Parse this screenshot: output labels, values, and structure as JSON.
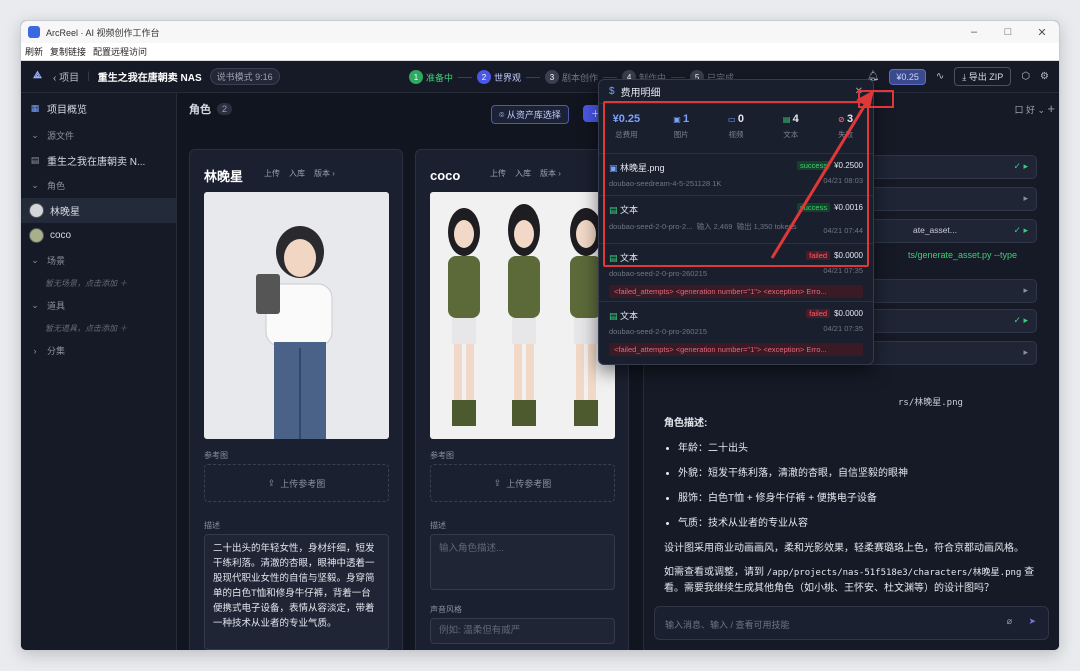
{
  "window": {
    "title": "ArcReel · AI 视频创作工作台",
    "controls": [
      "–",
      "□",
      "✕"
    ]
  },
  "menu": [
    "刷新",
    "复制链接",
    "配置远程访问"
  ],
  "topbar": {
    "back": "项目",
    "project_title": "重生之我在唐朝卖 NAS",
    "mode": "说书模式 9:16",
    "steps": [
      {
        "n": "1",
        "label": "准备中"
      },
      {
        "n": "2",
        "label": "世界观"
      },
      {
        "n": "3",
        "label": "剧本创作"
      },
      {
        "n": "4",
        "label": "制作中"
      },
      {
        "n": "5",
        "label": "已完成"
      }
    ],
    "cost": "¥0.25",
    "export": "导出 ZIP"
  },
  "sidebar": {
    "overview": "项目概览",
    "source": "源文件",
    "source_file": "重生之我在唐朝卖 N...",
    "characters": "角色",
    "char_items": [
      "林晚星",
      "coco"
    ],
    "scenes": "场景",
    "scenes_hint": "暂无场景，点击添加 ＋",
    "props": "道具",
    "props_hint": "暂无道具，点击添加 ＋",
    "episodes": "分集"
  },
  "main": {
    "title": "角色",
    "count": "2",
    "from_library": "从资产库选择",
    "add": "＋ 角色",
    "actions": [
      "上传",
      "入库",
      "版本 ›"
    ],
    "ref_label": "参考图",
    "upload_ref": "上传参考图",
    "desc_label": "描述",
    "voice_label": "声音风格",
    "cards": [
      {
        "name": "林晚星",
        "desc": "二十出头的年轻女性，身材纤细，短发干练利落。清澈的杏眼，眼神中透着一股现代职业女性的自信与坚毅。身穿简单的白色T恤和修身牛仔裤，背着一台便携式电子设备，表情从容淡定，带着一种技术从业者的专业气质。"
      },
      {
        "name": "coco",
        "desc_placeholder": "输入角色描述...",
        "voice_placeholder": "例如: 温柔但有威严"
      }
    ]
  },
  "chat": {
    "header": "口 好 ⌄",
    "tool_fragments": [
      "ate_asset...",
      "ts/generate_asset.py --type"
    ],
    "path_line": "rs/林晚星.png",
    "desc_heading": "角色描述:",
    "bullets": [
      "年龄：二十出头",
      "外貌：短发干练利落，清澈的杏眼，自信坚毅的眼神",
      "服饰：白色T恤 + 修身牛仔裤 + 便携电子设备",
      "气质：技术从业者的专业从容"
    ],
    "p1": "设计图采用商业动画画风，柔和光影效果，轻柔赛璐珞上色，符合京都动画风格。",
    "p2a": "如需查看或调整，请到 ",
    "p2path": "/app/projects/nas-51f518e3/characters/林晚星.png",
    "p2b": " 查看。需要我继续生成其他角色（如小桃、王怀安、杜文渊等）的设计图吗？",
    "input_placeholder": "输入消息、输入 / 查看可用技能"
  },
  "popup": {
    "title": "费用明细",
    "stats": [
      {
        "v": "¥0.25",
        "k": "总费用",
        "c": "#7aa2ff"
      },
      {
        "v": "1",
        "k": "图片",
        "c": "#7aa2ff"
      },
      {
        "v": "0",
        "k": "视频",
        "c": "#e4e7ee"
      },
      {
        "v": "4",
        "k": "文本",
        "c": "#3ccf77"
      },
      {
        "v": "3",
        "k": "失败",
        "c": "#ff5a6e"
      }
    ],
    "records": [
      {
        "title": "林晚星.png",
        "model": "doubao-seedream-4-5-251128  1K",
        "status": "success",
        "price": "¥0.2500",
        "time": "04/21 08:03"
      },
      {
        "title": "文本",
        "model": "doubao-seed-2-0-pro-2...",
        "in": "输入 2,469",
        "out": "输出 1,350 tokens",
        "status": "success",
        "price": "¥0.0016",
        "time": "04/21 07:44"
      },
      {
        "title": "文本",
        "model": "doubao-seed-2-0-pro-260215",
        "status": "failed",
        "price": "$0.0000",
        "time": "04/21 07:35",
        "error": "<failed_attempts> <generation number=\"1\"> <exception> Erro..."
      },
      {
        "title": "文本",
        "model": "doubao-seed-2-0-pro-260215",
        "status": "failed",
        "price": "$0.0000",
        "time": "04/21 07:35",
        "error": "<failed_attempts> <generation number=\"1\"> <exception> Erro..."
      }
    ]
  }
}
